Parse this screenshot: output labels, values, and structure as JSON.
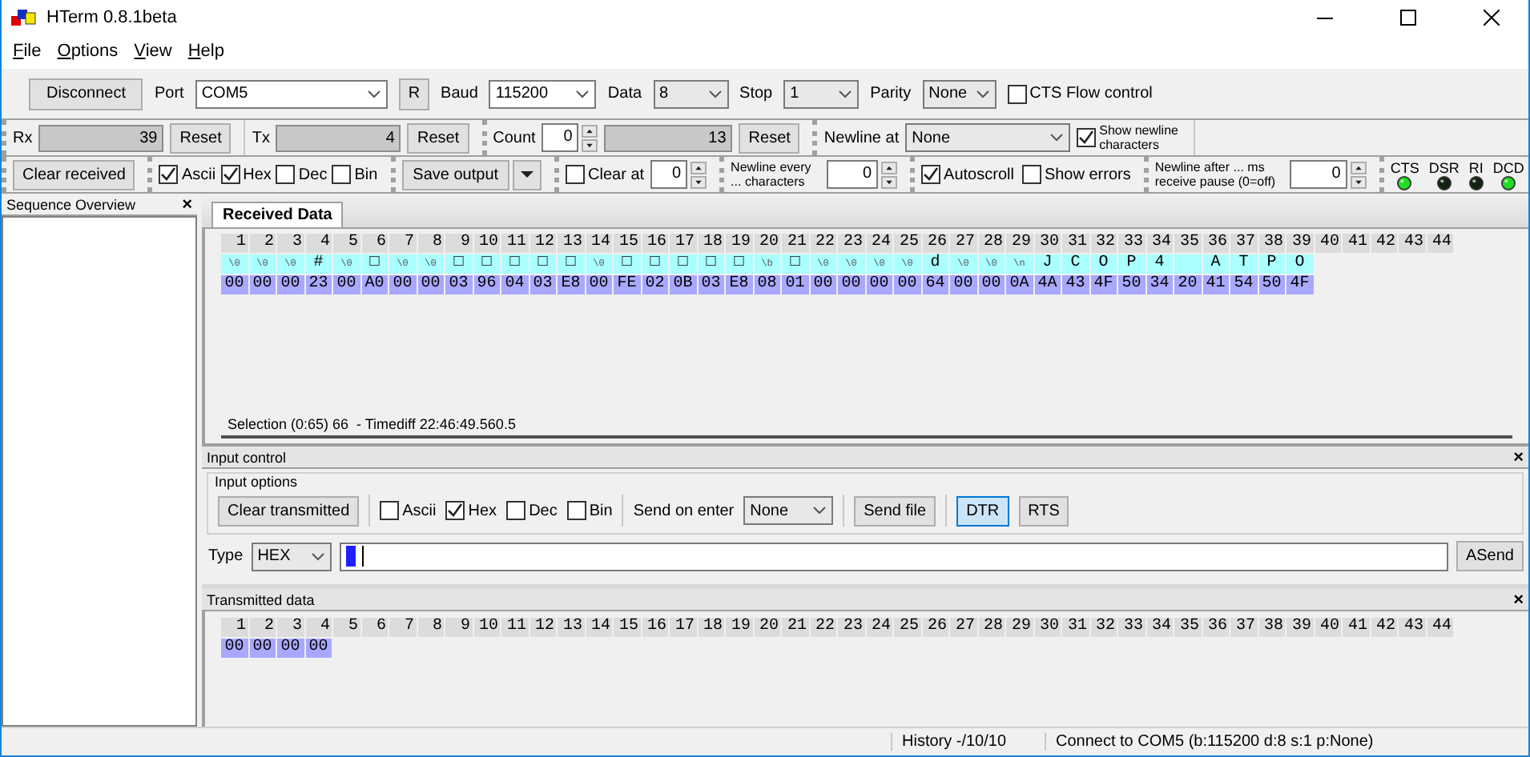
{
  "window": {
    "title": "HTerm 0.8.1beta"
  },
  "menu": [
    "File",
    "Options",
    "View",
    "Help"
  ],
  "connection": {
    "connect_button": "Disconnect",
    "port_label": "Port",
    "port": "COM5",
    "rescan_button": "R",
    "baud_label": "Baud",
    "baud": "115200",
    "data_label": "Data",
    "data": "8",
    "stop_label": "Stop",
    "stop": "1",
    "parity_label": "Parity",
    "parity": "None",
    "cts_flow": {
      "label": "CTS Flow control",
      "checked": false
    }
  },
  "counters": {
    "rx_label": "Rx",
    "rx": "39",
    "rx_reset": "Reset",
    "tx_label": "Tx",
    "tx": "4",
    "tx_reset": "Reset",
    "count_label": "Count",
    "count": "0",
    "count_value": "13",
    "count_reset": "Reset",
    "newline_label": "Newline at",
    "newline": "None",
    "show_newline": {
      "label": "Show newline characters",
      "checked": true
    }
  },
  "output": {
    "clear_button": "Clear received",
    "formats": [
      {
        "label": "Ascii",
        "checked": true
      },
      {
        "label": "Hex",
        "checked": true
      },
      {
        "label": "Dec",
        "checked": false
      },
      {
        "label": "Bin",
        "checked": false
      }
    ],
    "save_button": "Save output",
    "clear_at": {
      "label": "Clear at",
      "checked": false,
      "value": "0"
    },
    "newline_every": {
      "label": "Newline every ... characters",
      "value": "0"
    },
    "autoscroll": {
      "label": "Autoscroll",
      "checked": true
    },
    "show_errors": {
      "label": "Show errors",
      "checked": false
    },
    "newline_after": {
      "label": "Newline after ... ms receive pause (0=off)",
      "value": "0"
    },
    "signals": [
      {
        "label": "CTS",
        "on": true
      },
      {
        "label": "DSR",
        "on": false
      },
      {
        "label": "RI",
        "on": false
      },
      {
        "label": "DCD",
        "on": true
      }
    ]
  },
  "sequence_overview": {
    "title": "Sequence Overview",
    "close": "×"
  },
  "received": {
    "tab": "Received Data",
    "index": [
      "1",
      "2",
      "3",
      "4",
      "5",
      "6",
      "7",
      "8",
      "9",
      "10",
      "11",
      "12",
      "13",
      "14",
      "15",
      "16",
      "17",
      "18",
      "19",
      "20",
      "21",
      "22",
      "23",
      "24",
      "25",
      "26",
      "27",
      "28",
      "29",
      "30",
      "31",
      "32",
      "33",
      "34",
      "35",
      "36",
      "37",
      "38",
      "39",
      "40",
      "41",
      "42",
      "43",
      "44"
    ],
    "cells": [
      {
        "kind": "escape",
        "ascii": "\\0",
        "hex": "00"
      },
      {
        "kind": "escape",
        "ascii": "\\0",
        "hex": "00"
      },
      {
        "kind": "escape",
        "ascii": "\\0",
        "hex": "00"
      },
      {
        "kind": "char",
        "ascii": "#",
        "hex": "23"
      },
      {
        "kind": "escape",
        "ascii": "\\0",
        "hex": "00"
      },
      {
        "kind": "char",
        "ascii": "□",
        "hex": "A0"
      },
      {
        "kind": "escape",
        "ascii": "\\0",
        "hex": "00"
      },
      {
        "kind": "escape",
        "ascii": "\\0",
        "hex": "00"
      },
      {
        "kind": "char",
        "ascii": "□",
        "hex": "03"
      },
      {
        "kind": "char",
        "ascii": "□",
        "hex": "96"
      },
      {
        "kind": "char",
        "ascii": "□",
        "hex": "04"
      },
      {
        "kind": "char",
        "ascii": "□",
        "hex": "03"
      },
      {
        "kind": "char",
        "ascii": "□",
        "hex": "E8"
      },
      {
        "kind": "escape",
        "ascii": "\\0",
        "hex": "00"
      },
      {
        "kind": "char",
        "ascii": "□",
        "hex": "FE"
      },
      {
        "kind": "char",
        "ascii": "□",
        "hex": "02"
      },
      {
        "kind": "char",
        "ascii": "□",
        "hex": "0B"
      },
      {
        "kind": "char",
        "ascii": "□",
        "hex": "03"
      },
      {
        "kind": "char",
        "ascii": "□",
        "hex": "E8"
      },
      {
        "kind": "escape",
        "ascii": "\\b",
        "hex": "08"
      },
      {
        "kind": "char",
        "ascii": "□",
        "hex": "01"
      },
      {
        "kind": "escape",
        "ascii": "\\0",
        "hex": "00"
      },
      {
        "kind": "escape",
        "ascii": "\\0",
        "hex": "00"
      },
      {
        "kind": "escape",
        "ascii": "\\0",
        "hex": "00"
      },
      {
        "kind": "escape",
        "ascii": "\\0",
        "hex": "00"
      },
      {
        "kind": "char",
        "ascii": "d",
        "hex": "64"
      },
      {
        "kind": "escape",
        "ascii": "\\0",
        "hex": "00"
      },
      {
        "kind": "escape",
        "ascii": "\\0",
        "hex": "00"
      },
      {
        "kind": "escape",
        "ascii": "\\n",
        "hex": "0A"
      },
      {
        "kind": "char",
        "ascii": "J",
        "hex": "4A"
      },
      {
        "kind": "char",
        "ascii": "C",
        "hex": "43"
      },
      {
        "kind": "char",
        "ascii": "O",
        "hex": "4F"
      },
      {
        "kind": "char",
        "ascii": "P",
        "hex": "50"
      },
      {
        "kind": "char",
        "ascii": "4",
        "hex": "34"
      },
      {
        "kind": "blank",
        "hex": "20"
      },
      {
        "kind": "char",
        "ascii": "A",
        "hex": "41"
      },
      {
        "kind": "char",
        "ascii": "T",
        "hex": "54"
      },
      {
        "kind": "char",
        "ascii": "P",
        "hex": "50"
      },
      {
        "kind": "char",
        "ascii": "O",
        "hex": "4F"
      }
    ],
    "selection": "Selection (0:65) 66  - Timediff 22:46:49.560.5"
  },
  "input_control": {
    "title": "Input control",
    "close": "×",
    "options_title": "Input options",
    "clear_button": "Clear transmitted",
    "formats": [
      {
        "label": "Ascii",
        "checked": false
      },
      {
        "label": "Hex",
        "checked": true
      },
      {
        "label": "Dec",
        "checked": false
      },
      {
        "label": "Bin",
        "checked": false
      }
    ],
    "send_on_enter_label": "Send on enter",
    "send_on_enter": "None",
    "send_file": "Send file",
    "dtr": {
      "label": "DTR",
      "on": true
    },
    "rts": {
      "label": "RTS",
      "on": false
    },
    "type_label": "Type",
    "type": "HEX",
    "send_button": "ASend"
  },
  "transmitted": {
    "title": "Transmitted data",
    "close": "×",
    "index": [
      "1",
      "2",
      "3",
      "4",
      "5",
      "6",
      "7",
      "8",
      "9",
      "10",
      "11",
      "12",
      "13",
      "14",
      "15",
      "16",
      "17",
      "18",
      "19",
      "20",
      "21",
      "22",
      "23",
      "24",
      "25",
      "26",
      "27",
      "28",
      "29",
      "30",
      "31",
      "32",
      "33",
      "34",
      "35",
      "36",
      "37",
      "38",
      "39",
      "40",
      "41",
      "42",
      "43",
      "44"
    ],
    "hex": [
      "00",
      "00",
      "00",
      "00"
    ]
  },
  "status_bar": {
    "history": "History -/10/10",
    "connection": "Connect to COM5 (b:115200 d:8 s:1 p:None)"
  }
}
